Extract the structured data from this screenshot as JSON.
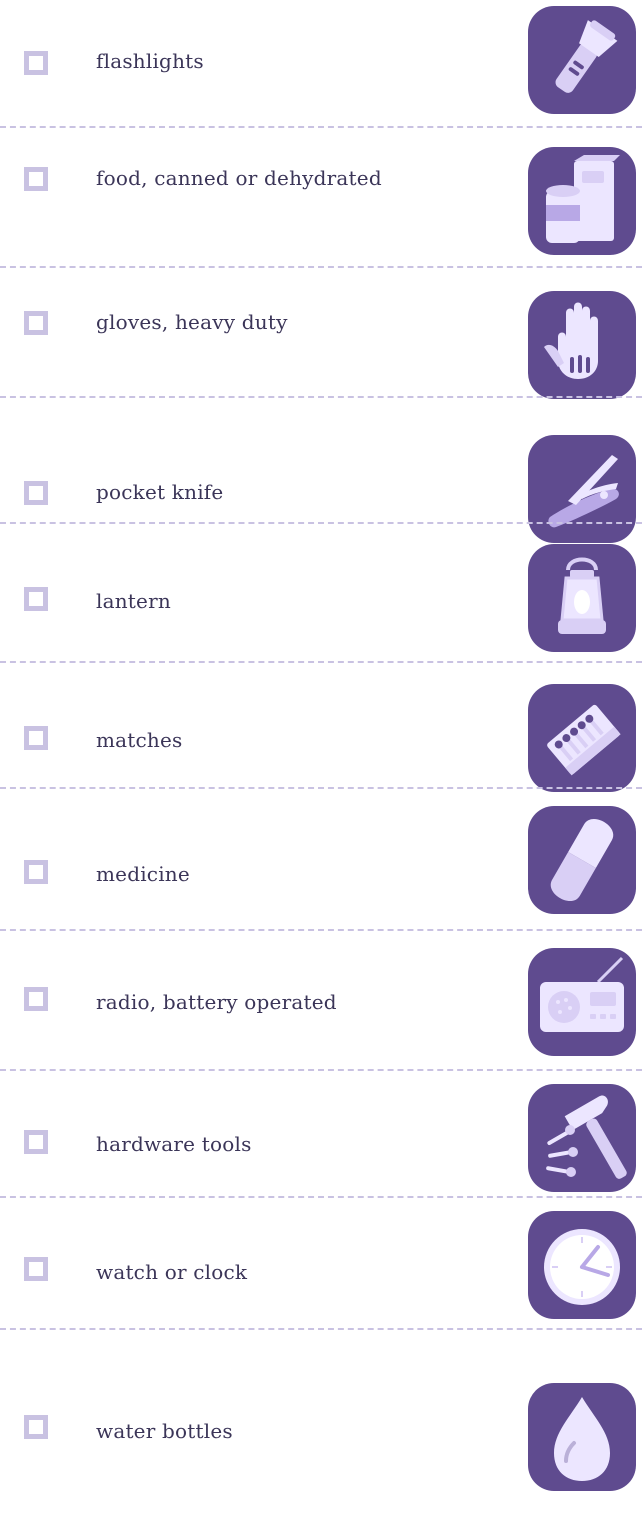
{
  "colors": {
    "tile": "#5f4b8f",
    "icon_fill": "#d9cff5",
    "icon_light": "#ece6ff",
    "checkbox_border": "#c9c2e2",
    "divider": "#c9c2e2",
    "text": "#3b3558"
  },
  "items": [
    {
      "label": "flashlights",
      "icon": "flashlight-icon",
      "checked": false
    },
    {
      "label": "food, canned or dehydrated",
      "icon": "food-icon",
      "checked": false
    },
    {
      "label": "gloves, heavy duty",
      "icon": "glove-icon",
      "checked": false
    },
    {
      "label": "pocket knife",
      "icon": "pocket-knife-icon",
      "checked": false
    },
    {
      "label": "lantern",
      "icon": "lantern-icon",
      "checked": false
    },
    {
      "label": "matches",
      "icon": "matches-icon",
      "checked": false
    },
    {
      "label": "medicine",
      "icon": "pill-icon",
      "checked": false
    },
    {
      "label": "radio, battery operated",
      "icon": "radio-icon",
      "checked": false
    },
    {
      "label": "hardware tools",
      "icon": "hammer-nails-icon",
      "checked": false
    },
    {
      "label": "watch or clock",
      "icon": "clock-icon",
      "checked": false
    },
    {
      "label": "water bottles",
      "icon": "water-drop-icon",
      "checked": false
    }
  ]
}
